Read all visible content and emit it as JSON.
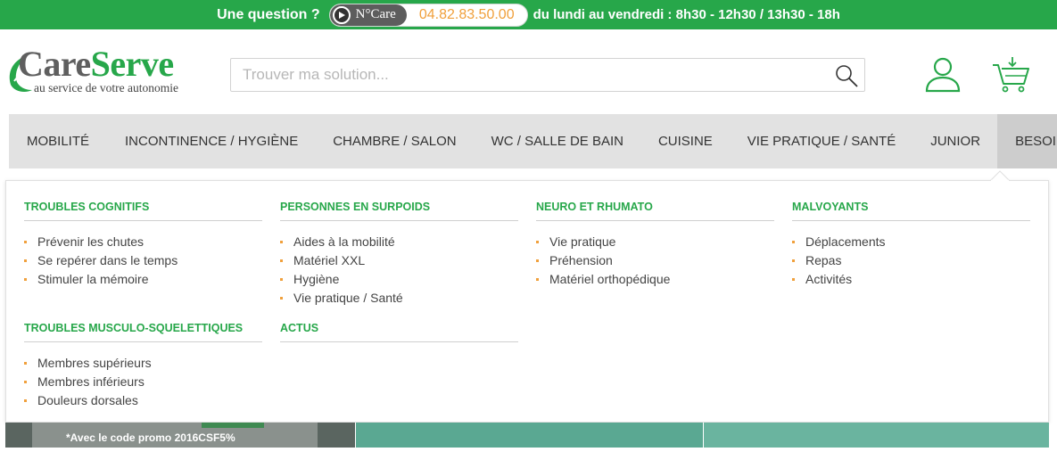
{
  "colors": {
    "brand_green": "#27a74a",
    "accent_orange": "#f0a03c",
    "nav_bg": "#e2e2e2",
    "nav_active_bg": "#cdcdcd"
  },
  "topbar": {
    "question": "Une question ?",
    "brand": "N°Care",
    "phone": "04.82.83.50.00",
    "hours": "du lundi au vendredi : 8h30 - 12h30 / 13h30 - 18h",
    "play_icon": "play-icon"
  },
  "logo": {
    "care": "Care",
    "serve": "Serve",
    "tagline": "au service de votre autonomie"
  },
  "search": {
    "placeholder": "Trouver ma solution...",
    "value": "",
    "icon": "search-icon"
  },
  "header_icons": {
    "account": "user-icon",
    "cart": "cart-icon"
  },
  "nav": {
    "items": [
      {
        "label": "MOBILITÉ"
      },
      {
        "label": "INCONTINENCE / HYGIÈNE"
      },
      {
        "label": "CHAMBRE / SALON"
      },
      {
        "label": "WC / SALLE DE BAIN"
      },
      {
        "label": "CUISINE"
      },
      {
        "label": "VIE PRATIQUE / SANTÉ"
      },
      {
        "label": "JUNIOR"
      },
      {
        "label": "BESOINS",
        "active": true
      }
    ]
  },
  "dropdown": {
    "sections": [
      {
        "title": "TROUBLES COGNITIFS",
        "links": [
          "Prévenir les chutes",
          "Se repérer dans le temps",
          "Stimuler la mémoire"
        ]
      },
      {
        "title": "PERSONNES EN SURPOIDS",
        "links": [
          "Aides à la mobilité",
          "Matériel XXL",
          "Hygiène",
          "Vie pratique / Santé"
        ]
      },
      {
        "title": "NEURO ET RHUMATO",
        "links": [
          "Vie pratique",
          "Préhension",
          "Matériel orthopédique"
        ]
      },
      {
        "title": "MALVOYANTS",
        "links": [
          "Déplacements",
          "Repas",
          "Activités"
        ]
      },
      {
        "title": "TROUBLES MUSCULO-SQUELETTIQUES",
        "links": [
          "Membres supérieurs",
          "Membres inférieurs",
          "Douleurs dorsales"
        ]
      },
      {
        "title": "ACTUS",
        "links": []
      }
    ]
  },
  "banners": {
    "promo": "*Avec le code promo 2016CSF5%"
  }
}
